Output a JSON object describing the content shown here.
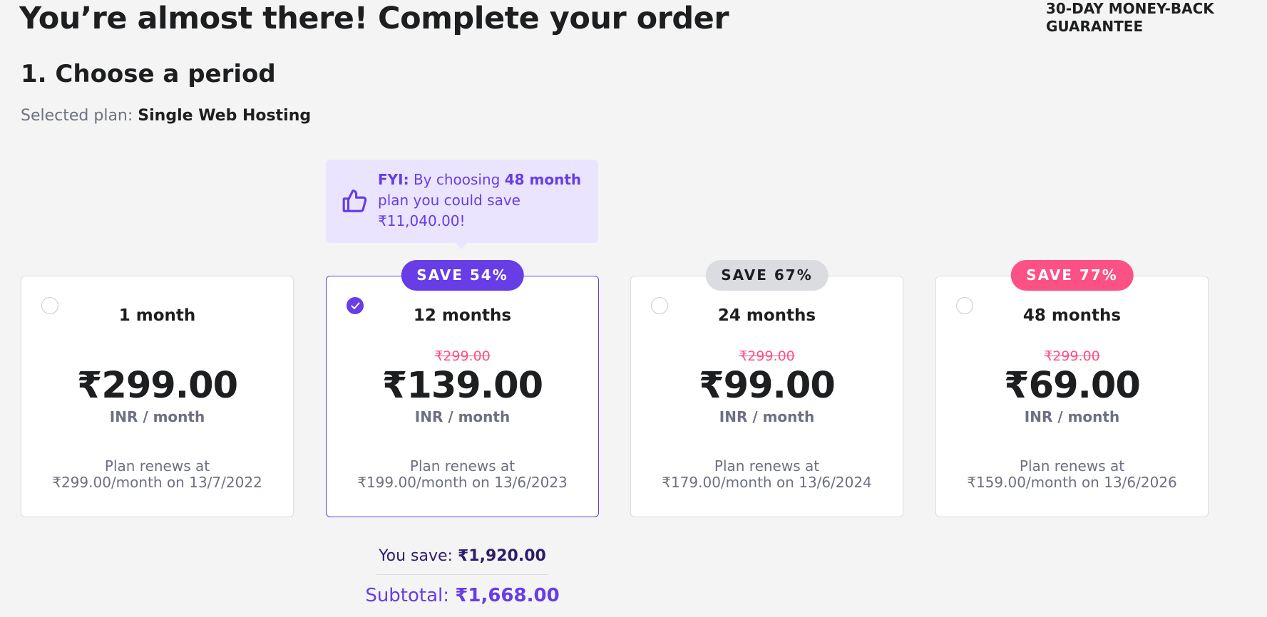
{
  "header": {
    "title": "You’re almost there! Complete your order",
    "guarantee": "30-DAY MONEY-BACK\nGUARANTEE"
  },
  "period_section": {
    "title": "1. Choose a period",
    "selected_plan_label": "Selected plan:",
    "selected_plan_value": "Single Web Hosting"
  },
  "fyi": {
    "icon": "thumbs-up-icon",
    "prefix": "FYI:",
    "text1": "By choosing",
    "highlight": "48 month",
    "text2": "plan you could save ₹11,040.00!"
  },
  "plans": [
    {
      "period": "1 month",
      "badge": "",
      "old_price": "",
      "price": "₹299.00",
      "unit": "INR / month",
      "renew": "Plan renews at\n₹299.00/month on 13/7/2022",
      "selected": false
    },
    {
      "period": "12 months",
      "badge": "SAVE 54%",
      "old_price": "₹299.00",
      "price": "₹139.00",
      "unit": "INR / month",
      "renew": "Plan renews at\n₹199.00/month on 13/6/2023",
      "selected": true
    },
    {
      "period": "24 months",
      "badge": "SAVE 67%",
      "old_price": "₹299.00",
      "price": "₹99.00",
      "unit": "INR / month",
      "renew": "Plan renews at\n₹179.00/month on 13/6/2024",
      "selected": false
    },
    {
      "period": "48 months",
      "badge": "SAVE 77%",
      "old_price": "₹299.00",
      "price": "₹69.00",
      "unit": "INR / month",
      "renew": "Plan renews at\n₹159.00/month on 13/6/2026",
      "selected": false
    }
  ],
  "summary": {
    "you_save_label": "You save:",
    "you_save_value": "₹1,920.00",
    "subtotal_label": "Subtotal:",
    "subtotal_value": "₹1,668.00"
  },
  "colors": {
    "accent": "#673de6",
    "badge_selected_bg": "#673de6",
    "badge_neutral_bg": "#dadce0",
    "badge_hot_bg": "#fc5185",
    "strike_price": "#fc5185",
    "fyi_bg": "#ebe4ff"
  }
}
